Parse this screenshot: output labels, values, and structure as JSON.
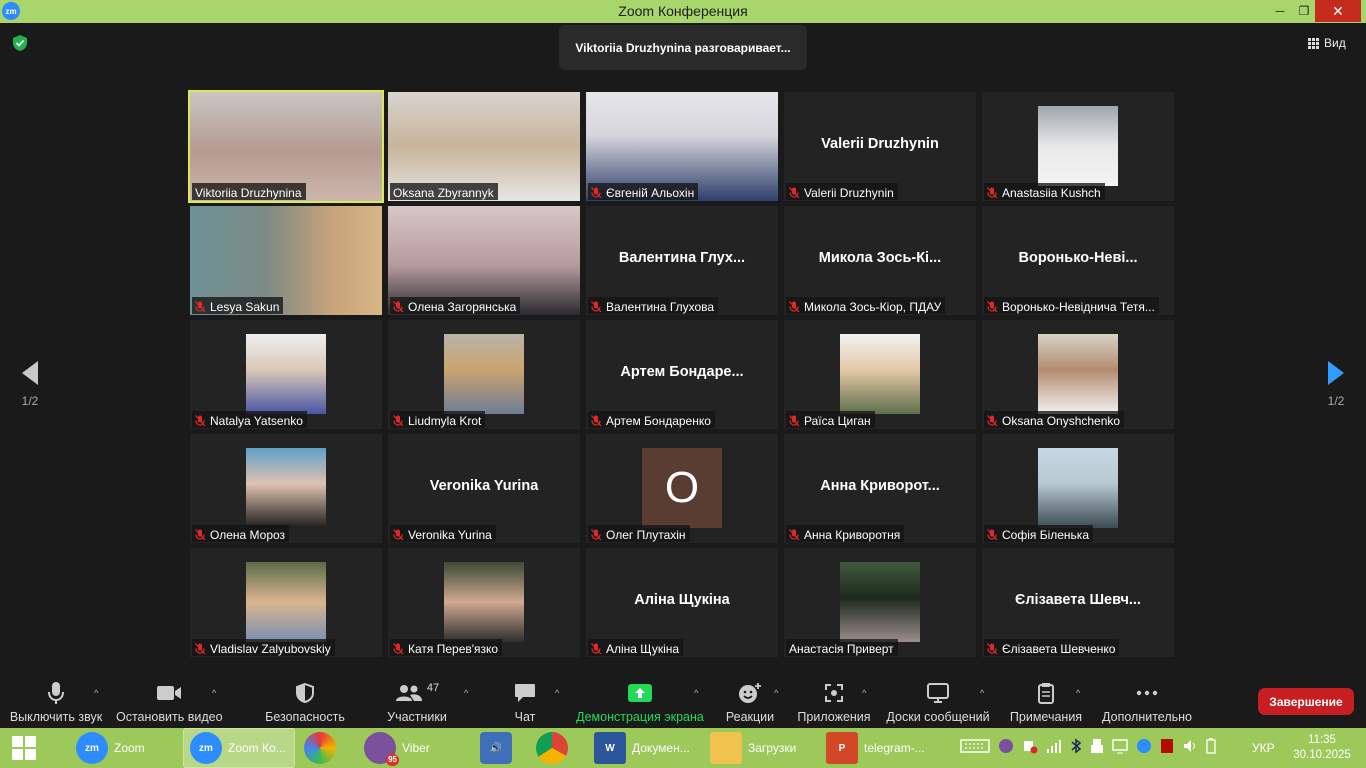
{
  "window": {
    "title": "Zoom Конференция",
    "logo": "zm"
  },
  "header": {
    "speaking_banner": "Viktoriia Druzhynina разговаривает...",
    "view_label": "Вид"
  },
  "nav": {
    "page_left": "1/2",
    "page_right": "1/2"
  },
  "participants": [
    {
      "name": "Viktoriia Druzhynina",
      "muted": false,
      "mode": "video",
      "speaker": true
    },
    {
      "name": "Oksana Zbyrannyk",
      "muted": false,
      "mode": "video"
    },
    {
      "name": "Євгеній Альохін",
      "muted": true,
      "mode": "video"
    },
    {
      "name": "Valerii Druzhynin",
      "muted": true,
      "mode": "name",
      "display": "Valerii Druzhynin"
    },
    {
      "name": "Anastasiia Kushch",
      "muted": true,
      "mode": "photo"
    },
    {
      "name": "Lesya Sakun",
      "muted": true,
      "mode": "video"
    },
    {
      "name": "Олена Загорянська",
      "muted": true,
      "mode": "video"
    },
    {
      "name": "Валентина Глухова",
      "muted": true,
      "mode": "name",
      "display": "Валентина  Глух..."
    },
    {
      "name": "Микола Зось-Кіор, ПДАУ",
      "muted": true,
      "mode": "name",
      "display": "Микола  Зось-Кі..."
    },
    {
      "name": "Воронько-Невіднича Тетя...",
      "muted": true,
      "mode": "name",
      "display": "Воронько-Неві..."
    },
    {
      "name": "Natalya Yatsenko",
      "muted": true,
      "mode": "photo"
    },
    {
      "name": "Liudmyla Krot",
      "muted": true,
      "mode": "photo"
    },
    {
      "name": "Артем Бондаренко",
      "muted": true,
      "mode": "name",
      "display": "Артем  Бондаре..."
    },
    {
      "name": "Раїса Циган",
      "muted": true,
      "mode": "photo"
    },
    {
      "name": "Oksana Onyshchenko",
      "muted": true,
      "mode": "photo"
    },
    {
      "name": "Олена Мороз",
      "muted": true,
      "mode": "photo"
    },
    {
      "name": "Veronika Yurina",
      "muted": true,
      "mode": "name",
      "display": "Veronika Yurina"
    },
    {
      "name": "Олег Плутахін",
      "muted": true,
      "mode": "letter",
      "display": "О"
    },
    {
      "name": "Анна Криворотня",
      "muted": true,
      "mode": "name",
      "display": "Анна  Криворот..."
    },
    {
      "name": "Софія Біленька",
      "muted": true,
      "mode": "photo"
    },
    {
      "name": "Vladislav Zalyubovskiy",
      "muted": true,
      "mode": "photo"
    },
    {
      "name": "Катя Перев'язко",
      "muted": true,
      "mode": "photo"
    },
    {
      "name": "Аліна Щукіна",
      "muted": true,
      "mode": "name",
      "display": "Аліна Щукіна"
    },
    {
      "name": "Анастасія Приверт",
      "muted": false,
      "mode": "photo"
    },
    {
      "name": "Єлізавета Шевченко",
      "muted": true,
      "mode": "name",
      "display": "Єлізавета  Шевч..."
    }
  ],
  "toolbar": {
    "mute": "Выключить звук",
    "video": "Остановить видео",
    "security": "Безопасность",
    "participants": "Участники",
    "participants_count": "47",
    "chat": "Чат",
    "share": "Демонстрация экрана",
    "reactions": "Реакции",
    "apps": "Приложения",
    "whiteboards": "Доски сообщений",
    "notes": "Примечания",
    "more": "Дополнительно",
    "end": "Завершение"
  },
  "taskbar": {
    "items": [
      {
        "label": "Zoom",
        "icon": "zm"
      },
      {
        "label": "Zoom Ко...",
        "icon": "zm"
      },
      {
        "label": "",
        "icon": "picasa"
      },
      {
        "label": "Viber",
        "icon": "viber",
        "badge": "95"
      },
      {
        "label": "",
        "icon": "sound"
      },
      {
        "label": "",
        "icon": "chrome"
      },
      {
        "label": "Докумен...",
        "icon": "word"
      },
      {
        "label": "Загрузки",
        "icon": "folder"
      },
      {
        "label": "telegram-...",
        "icon": "powerpoint"
      }
    ],
    "lang": "УКР",
    "time": "11:35",
    "date": "30.10.2025"
  },
  "colors": {
    "accent": "#a9d66c",
    "speaker_border": "#d9eb53",
    "share_green": "#23d959",
    "end_red": "#c71e22"
  }
}
